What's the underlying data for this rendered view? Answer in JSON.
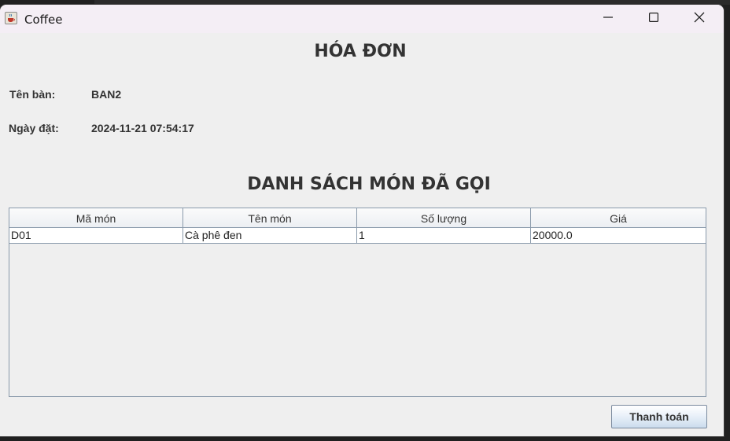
{
  "window": {
    "title": "Coffee",
    "icon": "java-cup-icon",
    "controls": [
      "minimize-icon",
      "maximize-icon",
      "close-icon"
    ]
  },
  "invoice": {
    "heading": "HÓA ĐƠN",
    "table_label": "Tên bàn:",
    "table_value": "BAN2",
    "date_label": "Ngày đặt:",
    "date_value": "2024-11-21 07:54:17"
  },
  "orders": {
    "heading": "DANH SÁCH MÓN ĐÃ GỌI",
    "columns": [
      "Mã món",
      "Tên món",
      "Số lượng",
      "Giá"
    ],
    "rows": [
      [
        "D01",
        "Cà phê đen",
        "1",
        "20000.0"
      ]
    ]
  },
  "actions": {
    "pay_label": "Thanh toán"
  }
}
